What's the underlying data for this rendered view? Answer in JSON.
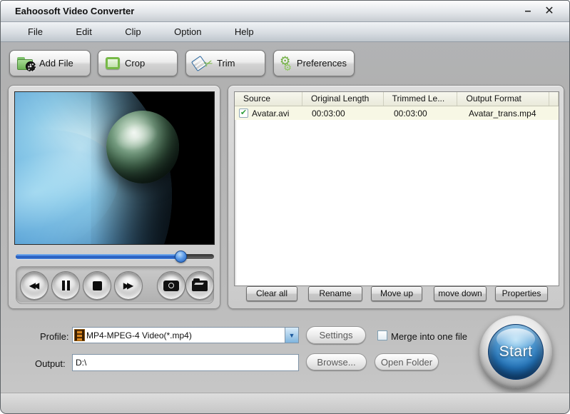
{
  "window": {
    "title": "Eahoosoft Video Converter"
  },
  "icons": {
    "minimize": "–",
    "close": "✕",
    "scissors": "✂",
    "gear_large": "⚙",
    "gear_small": "⚙",
    "rewind": "◀◀",
    "forward": "▶▶",
    "dropdown_arrow": "▼",
    "row_check": "✔"
  },
  "menu": {
    "items": [
      {
        "label": "File"
      },
      {
        "label": "Edit"
      },
      {
        "label": "Clip"
      },
      {
        "label": "Option"
      },
      {
        "label": "Help"
      }
    ]
  },
  "toolbar": {
    "buttons": [
      {
        "label": "Add File"
      },
      {
        "label": "Crop"
      },
      {
        "label": "Trim"
      },
      {
        "label": "Preferences"
      }
    ]
  },
  "player": {
    "progress_percent": 83
  },
  "file_list": {
    "columns": [
      "Source",
      "Original Length",
      "Trimmed Le...",
      "Output Format"
    ],
    "rows": [
      {
        "checked": true,
        "source": "Avatar.avi",
        "original_length": "00:03:00",
        "trimmed_length": "00:03:00",
        "output_format": "Avatar_trans.mp4"
      }
    ]
  },
  "list_actions": {
    "clear_all": "Clear all",
    "rename": "Rename",
    "move_up": "Move up",
    "move_down": "move down",
    "properties": "Properties"
  },
  "output_settings": {
    "profile_label": "Profile:",
    "profile_value": "MP4-MPEG-4 Video(*.mp4)",
    "settings_label": "Settings",
    "merge_label": "Merge into one file",
    "merge_checked": false,
    "output_label": "Output:",
    "output_value": "D:\\",
    "browse_label": "Browse...",
    "open_folder_label": "Open Folder",
    "start_label": "Start"
  }
}
